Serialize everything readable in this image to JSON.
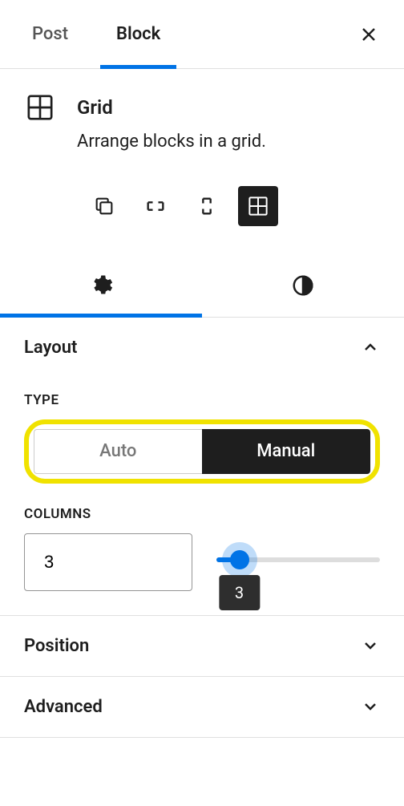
{
  "tabs": {
    "post": "Post",
    "block": "Block",
    "active": "Block"
  },
  "block": {
    "title": "Grid",
    "description": "Arrange blocks in a grid."
  },
  "sections": {
    "layout": {
      "label": "Layout",
      "type_label": "TYPE",
      "type_options": {
        "auto": "Auto",
        "manual": "Manual"
      },
      "type_selected": "Manual",
      "columns_label": "COLUMNS",
      "columns_value": "3",
      "slider_tooltip": "3"
    },
    "position": {
      "label": "Position"
    },
    "advanced": {
      "label": "Advanced"
    }
  }
}
